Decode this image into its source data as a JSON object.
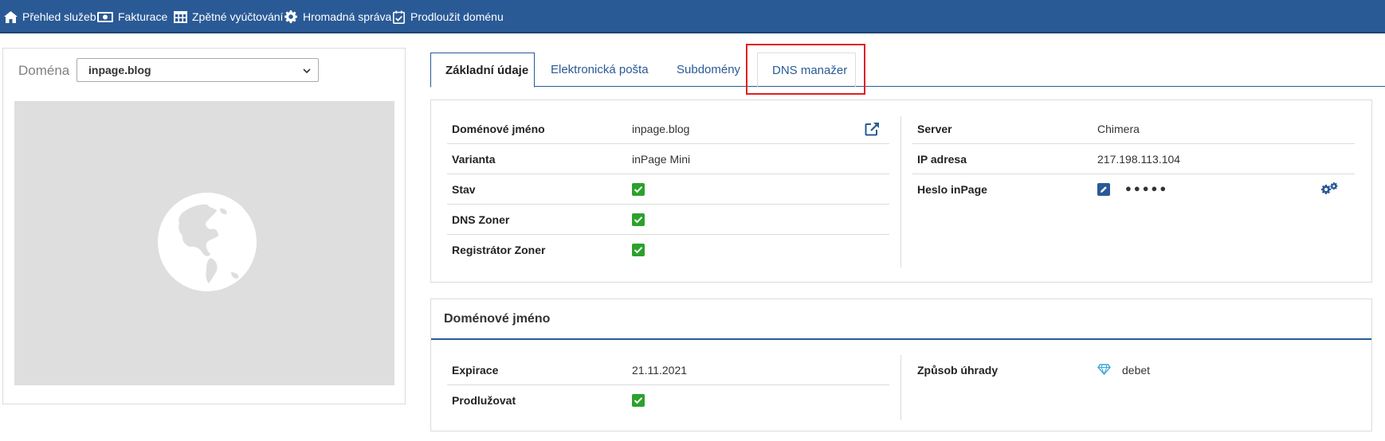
{
  "nav": [
    {
      "label": "Přehled služeb",
      "icon": "home-icon"
    },
    {
      "label": "Fakturace",
      "icon": "money-icon"
    },
    {
      "label": "Zpětné vyúčtování",
      "icon": "table-icon"
    },
    {
      "label": "Hromadná správa",
      "icon": "gear-icon"
    },
    {
      "label": "Prodloužit doménu",
      "icon": "calendar-check-icon"
    }
  ],
  "left": {
    "domain_label": "Doména",
    "selected_domain": "inpage.blog"
  },
  "tabs": [
    {
      "label": "Základní údaje",
      "active": true
    },
    {
      "label": "Elektronická pošta",
      "active": false
    },
    {
      "label": "Subdomény",
      "active": false
    },
    {
      "label": "DNS manažer",
      "active": false
    }
  ],
  "basic": {
    "left_rows": [
      {
        "label": "Doménové jméno",
        "value": "inpage.blog"
      },
      {
        "label": "Varianta",
        "value": "inPage Mini"
      },
      {
        "label": "Stav",
        "checked": true
      },
      {
        "label": "DNS Zoner",
        "checked": true
      },
      {
        "label": "Registrátor Zoner",
        "checked": true
      }
    ],
    "right_rows": [
      {
        "label": "Server",
        "value": "Chimera"
      },
      {
        "label": "IP adresa",
        "value": "217.198.113.104"
      },
      {
        "label": "Heslo inPage",
        "value": "●●●●●"
      }
    ]
  },
  "domain_card": {
    "title": "Doménové jméno",
    "left_rows": [
      {
        "label": "Expirace",
        "value": "21.11.2021"
      },
      {
        "label": "Prodlužovat",
        "checked": true
      }
    ],
    "right_rows": [
      {
        "label": "Způsob úhrady",
        "value": "debet"
      }
    ]
  },
  "colors": {
    "nav_bg": "#2a5a96",
    "check_green": "#2ca12c",
    "highlight_red": "#e02020",
    "diamond_blue": "#3aa7d8"
  }
}
